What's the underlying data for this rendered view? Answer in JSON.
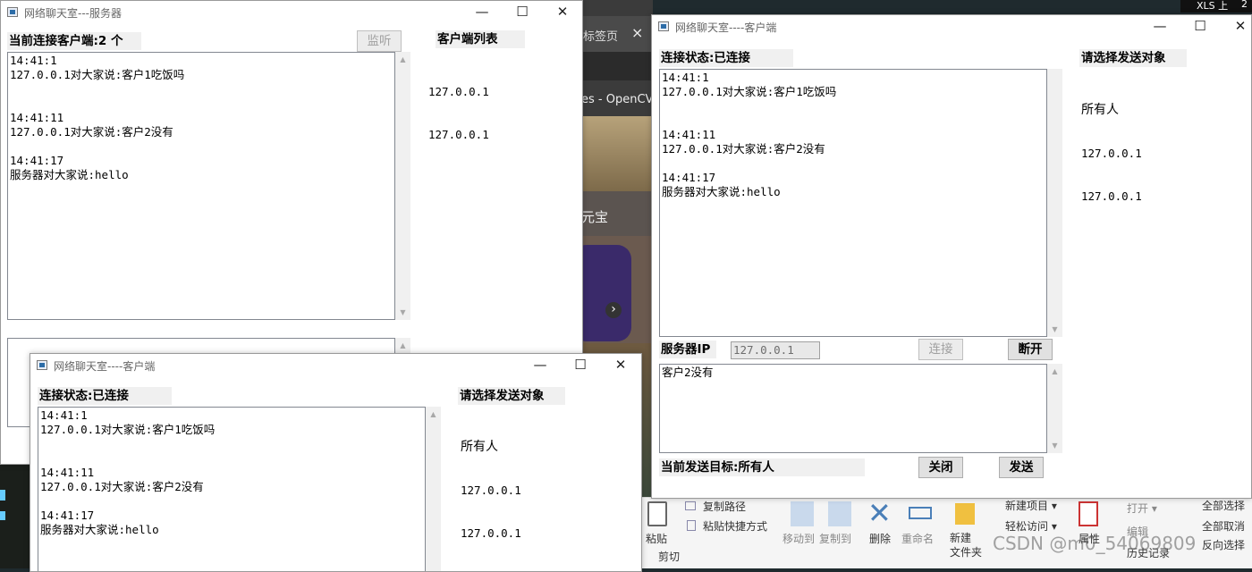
{
  "background": {
    "browser_tab": "标签页",
    "browser_tab_close": "×",
    "browser_link": "es - OpenCV",
    "browser_text": "元宝",
    "browser_next": "›",
    "taskbar_text": "XLS 上",
    "taskbar_num": "2",
    "ribbon": {
      "copy_path": "复制路径",
      "paste_shortcut": "粘贴快捷方式",
      "paste": "粘贴",
      "cut": "剪切",
      "move_to": "移动到",
      "copy_to": "复制到",
      "delete": "删除",
      "rename": "重命名",
      "new_folder": "新建\n文件夹",
      "new_item": "新建项目 ▾",
      "easy_access": "轻松访问 ▾",
      "properties": "属性",
      "open": "打开 ▾",
      "edit": "编辑",
      "history": "历史记录",
      "select_all": "全部选择",
      "select_none": "全部取消",
      "invert": "反向选择"
    },
    "watermark": "CSDN @m0_54069809"
  },
  "server": {
    "title": "网络聊天室---服务器",
    "connected_label": "当前连接客户端:2 个",
    "listen_button": "监听",
    "client_list_header": "客户端列表",
    "clients": [
      "127.0.0.1",
      "127.0.0.1"
    ],
    "log": "14:41:1\n127.0.0.1对大家说:客户1吃饭吗\n\n\n14:41:11\n127.0.0.1对大家说:客户2没有\n\n14:41:17\n服务器对大家说:hello"
  },
  "client_right": {
    "title": "网络聊天室----客户端",
    "status": "连接状态:已连接",
    "target_header": "请选择发送对象",
    "targets": [
      "所有人",
      "127.0.0.1",
      "127.0.0.1"
    ],
    "log": "14:41:1\n127.0.0.1对大家说:客户1吃饭吗\n\n\n14:41:11\n127.0.0.1对大家说:客户2没有\n\n14:41:17\n服务器对大家说:hello",
    "server_ip_label": "服务器IP",
    "server_ip_value": "127.0.0.1",
    "connect_button": "连接",
    "disconnect_button": "断开",
    "compose_text": "客户2没有",
    "current_target": "当前发送目标:所有人",
    "close_button": "关闭",
    "send_button": "发送"
  },
  "client_bottom": {
    "title": "网络聊天室----客户端",
    "status": "连接状态:已连接",
    "target_header": "请选择发送对象",
    "targets": [
      "所有人",
      "127.0.0.1",
      "127.0.0.1"
    ],
    "log": "14:41:1\n127.0.0.1对大家说:客户1吃饭吗\n\n\n14:41:11\n127.0.0.1对大家说:客户2没有\n\n14:41:17\n服务器对大家说:hello"
  },
  "window_controls": {
    "minimize": "—",
    "maximize": "☐",
    "close": "✕"
  },
  "scroll": {
    "up": "▲",
    "down": "▼"
  }
}
